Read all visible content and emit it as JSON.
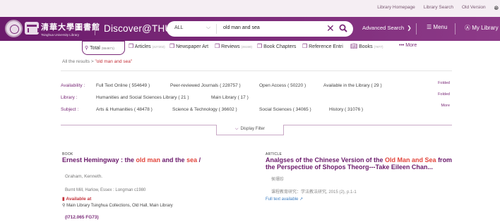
{
  "util_links": [
    "Library Homepage",
    "Library Search",
    "Old Version"
  ],
  "header": {
    "logo_cn": "清華大學圖書館",
    "logo_en": "Tsinghua University Library",
    "brand": "Discover@THU",
    "scope": "ALL",
    "query": "old man and sea",
    "advanced": "Advanced Search",
    "menu": "Menu",
    "mylib": "My Library"
  },
  "tabs": {
    "total_label": "Total",
    "total_count": "(554671)",
    "items": [
      {
        "label": "Articles",
        "count": "(427202)"
      },
      {
        "label": "Newspaper Art",
        "count": ""
      },
      {
        "label": "Reviews",
        "count": "(46159)"
      },
      {
        "label": "Book Chapters",
        "count": ""
      },
      {
        "label": "Reference Entri",
        "count": ""
      },
      {
        "label": "Books",
        "count": "(7877)"
      }
    ],
    "more": "More"
  },
  "breadcrumb": {
    "prefix": "All the results >",
    "query": "\"old man and sea\""
  },
  "facets": {
    "availability": {
      "label": "Availability :",
      "items": [
        "Full Text Online ( 554649 )",
        "Peer-reviewed Journals ( 228757 )",
        "Open Access ( 50220 )",
        "Available in the Library ( 29 )"
      ],
      "action": "Folded"
    },
    "library": {
      "label": "Library :",
      "items": [
        "Humanities and Social Sciences Library ( 21 )",
        "Main Library ( 17 )"
      ],
      "action": "Folded"
    },
    "subject": {
      "label": "Subject :",
      "items": [
        "Arts & Humanities ( 48478 )",
        "Science & Technology ( 36602 )",
        "Social Sciences ( 34065 )",
        "History ( 31076 )"
      ],
      "action": "More"
    }
  },
  "display_filter": "Display Filter",
  "result1": {
    "type": "BOOK",
    "title_a": "Ernest Hemingway : the ",
    "title_b": "old man",
    "title_c": " and the ",
    "title_d": "sea",
    "title_e": " /",
    "author": "Graham, Kenneth.",
    "publisher": "Burnt Mill, Harlow, Essex : Longman c1980",
    "availability": "Available at",
    "location": "Main Library Tsinghua Collections, Old Hall, Main Library",
    "call_number": "(I712.065 FG73)"
  },
  "result2": {
    "type": "ARTICLE",
    "title_a": "Analgses of the Chinese Version of the ",
    "title_b": "Old Man and Sea",
    "title_c": " from the Perspectiue of Shopos Theorg---Take Eileen Chan...",
    "author": "侯珊珍",
    "source": "课程教育研究：学法教法研究, 2015 (2), p.1-1",
    "link": "Full text available"
  }
}
